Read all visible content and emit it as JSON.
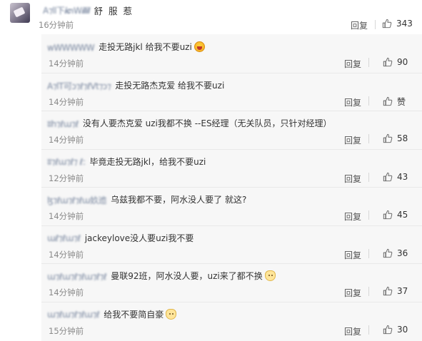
{
  "main_comment": {
    "name_blurred": "A⁊ll下𝒊𝒄℩W𝒊𝒍𝒊𝒍",
    "name_suffix": "舒 服 惹",
    "time": "16分钟前",
    "reply_label": "回复",
    "likes": "343"
  },
  "replies": [
    {
      "name_blurred": "wWWWWW",
      "text": "走投无路jkl 给我不要uzi",
      "emoji": "laugh-emoji",
      "time": "14分钟前",
      "reply_label": "回复",
      "likes": "90"
    },
    {
      "name_blurred": "A⁊lT可ɔ⁊ℓ⁊ℓVt⁊ɔ⁊",
      "text": "走投无路杰克爱 给我不要uzi",
      "emoji": "",
      "time": "14分钟前",
      "reply_label": "回复",
      "likes": "赞"
    },
    {
      "name_blurred": "ʬh⁊ℓɯ⁊ℓ",
      "text": "没有人要杰克爱  uzi我都不换  --ES经理（无关队员，只针对经理）",
      "emoji": "",
      "time": "14分钟前",
      "reply_label": "回复",
      "likes": "58"
    },
    {
      "name_blurred": "ʬ⁊ℓɯ⁊ℓ⁊ ℓ:",
      "text": "毕竟走投无路jkl，给我不要uzi",
      "emoji": "",
      "time": "12分钟前",
      "reply_label": "回复",
      "likes": "43"
    },
    {
      "name_blurred": "ɮ⁊ℓɯ⁊ℓ⁊ℓɯ奺迆",
      "text": "乌兹我都不要，阿水没人要了 就这?",
      "emoji": "",
      "time": "14分钟前",
      "reply_label": "回复",
      "likes": "45"
    },
    {
      "name_blurred": "ɯℓ⁊ℓɯ⁊ℓ",
      "text": "jackeylove没人要uzi我不要",
      "emoji": "",
      "time": "14分钟前",
      "reply_label": "回复",
      "likes": "36"
    },
    {
      "name_blurred": "ɯ⁊ℓɯ⁊ℓ⁊ℓɯ⁊ℓ⁊ℓ",
      "text": "曼联92班，阿水没人要，uzi来了都不换",
      "emoji": "cat-emoji",
      "time": "14分钟前",
      "reply_label": "回复",
      "likes": "37"
    },
    {
      "name_blurred": "ɯ⁊ℓɯ⁊ℓ⁊ℓɯ⁊ℓ",
      "text": "给我不要简自豪",
      "emoji": "cat-emoji",
      "time": "15分钟前",
      "reply_label": "回复",
      "likes": "30"
    }
  ],
  "colors": {
    "reply_bg": "#f7f7f7",
    "meta_gray": "#8a8a8a",
    "name_blue": "#5e6f8c"
  },
  "icons": {
    "like": "thumbs-up-icon"
  }
}
